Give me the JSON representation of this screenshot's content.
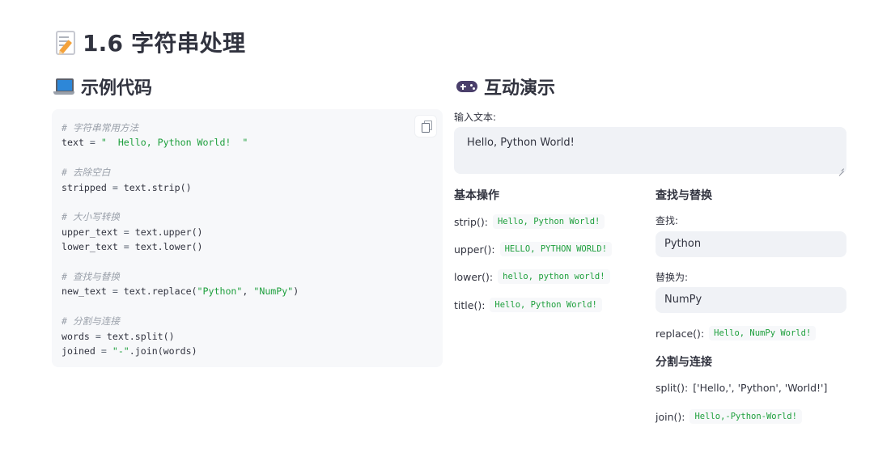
{
  "page": {
    "title": "1.6 字符串处理"
  },
  "code_section": {
    "title": "示例代码",
    "lines": [
      {
        "type": "comment",
        "text": "# 字符串常用方法"
      },
      {
        "type": "assign",
        "var": "text",
        "op": " = ",
        "str": "\"  Hello, Python World!  \""
      },
      {
        "type": "blank"
      },
      {
        "type": "comment",
        "text": "# 去除空白"
      },
      {
        "type": "assign",
        "var": "stripped",
        "op": " = ",
        "rest": "text.strip()"
      },
      {
        "type": "blank"
      },
      {
        "type": "comment",
        "text": "# 大小写转换"
      },
      {
        "type": "assign",
        "var": "upper_text",
        "op": " = ",
        "rest": "text.upper()"
      },
      {
        "type": "assign",
        "var": "lower_text",
        "op": " = ",
        "rest": "text.lower()"
      },
      {
        "type": "blank"
      },
      {
        "type": "comment",
        "text": "# 查找与替换"
      },
      {
        "type": "replace",
        "var": "new_text",
        "op": " = ",
        "pre": "text.replace(",
        "a": "\"Python\"",
        "sep": ", ",
        "b": "\"NumPy\"",
        "post": ")"
      },
      {
        "type": "blank"
      },
      {
        "type": "comment",
        "text": "# 分割与连接"
      },
      {
        "type": "assign",
        "var": "words",
        "op": " = ",
        "rest": "text.split()"
      },
      {
        "type": "join",
        "var": "joined",
        "op": " = ",
        "str": "\"-\"",
        "rest": ".join(words)"
      }
    ]
  },
  "demo_section": {
    "title": "互动演示",
    "input_label": "输入文本:",
    "input_value": "Hello, Python World!",
    "basic": {
      "heading": "基本操作",
      "rows": [
        {
          "label": "strip():",
          "value": "Hello, Python World!"
        },
        {
          "label": "upper():",
          "value": "HELLO, PYTHON WORLD!"
        },
        {
          "label": "lower():",
          "value": "hello, python world!"
        },
        {
          "label": "title():",
          "value": "Hello, Python World!"
        }
      ]
    },
    "find_replace": {
      "heading": "查找与替换",
      "find_label": "查找:",
      "find_value": "Python",
      "replace_label": "替换为:",
      "replace_value": "NumPy",
      "result_label": "replace():",
      "result_value": "Hello, NumPy World!"
    },
    "split_join": {
      "heading": "分割与连接",
      "split_label": "split():",
      "split_value": "['Hello,', 'Python', 'World!']",
      "join_label": "join():",
      "join_value": "Hello,-Python-World!"
    }
  }
}
